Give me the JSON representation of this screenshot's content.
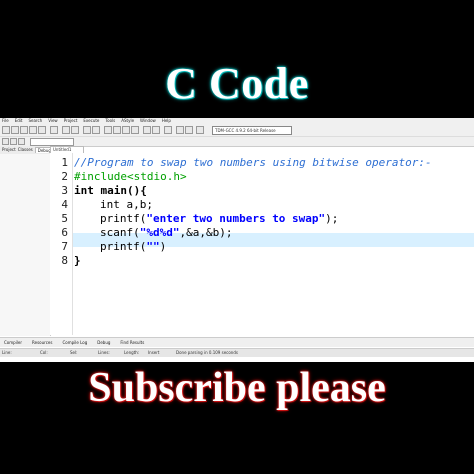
{
  "overlay": {
    "top_title": "C Code",
    "bottom_title": "Subscribe please"
  },
  "ide": {
    "menu": [
      "File",
      "Edit",
      "Search",
      "View",
      "Project",
      "Execute",
      "Tools",
      "AStyle",
      "Window",
      "Help"
    ],
    "compiler": "TDM-GCC 4.9.2 64-bit Release",
    "left_tabs": [
      "Project",
      "Classes",
      "Debug"
    ],
    "file_tab": "Untitled1",
    "lines": [
      {
        "num": "1",
        "text": "//Program to swap two numbers using bitwise operator:-"
      },
      {
        "num": "2",
        "text": "#include<stdio.h>"
      },
      {
        "num": "3",
        "text": "int main(){"
      },
      {
        "num": "4",
        "text": "int a,b;"
      },
      {
        "num": "5",
        "text": "printf(\"enter two numbers to swap\");"
      },
      {
        "num": "6",
        "text": "scanf(\"%d%d\",&a,&b);"
      },
      {
        "num": "7",
        "text": "printf(\"\")"
      },
      {
        "num": "8",
        "text": "}"
      }
    ],
    "bottom_tabs": [
      "Compiler",
      "Resources",
      "Compile Log",
      "Debug",
      "Find Results"
    ],
    "status": {
      "line": "Line:",
      "col": "Col:",
      "sel": "Sel:",
      "lines": "Lines:",
      "length": "Length:",
      "mode": "Insert",
      "message": "Done parsing in 0.109 seconds"
    }
  }
}
